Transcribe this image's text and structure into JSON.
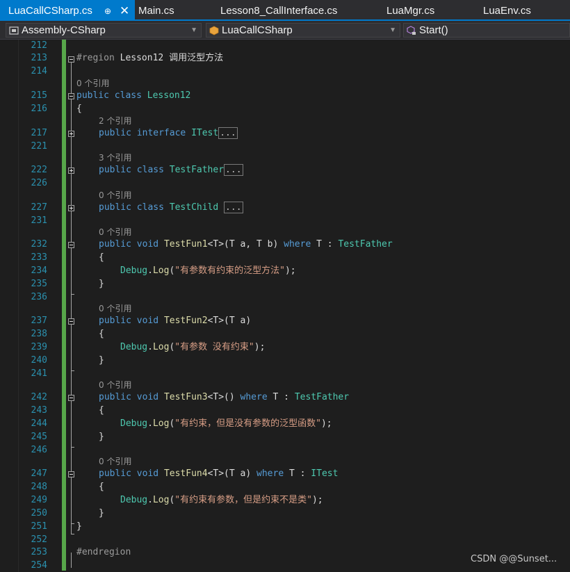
{
  "tabs": [
    {
      "label": "LuaCallCSharp.cs",
      "active": true
    },
    {
      "label": "Main.cs"
    },
    {
      "label": "Lesson8_CallInterface.cs"
    },
    {
      "label": "LuaMgr.cs"
    },
    {
      "label": "LuaEnv.cs"
    }
  ],
  "tab_pin_glyph": "⊕",
  "tab_close_glyph": "✕",
  "nav": {
    "project": "Assembly-CSharp",
    "type": "LuaCallCSharp",
    "member": "Start()"
  },
  "colors": {
    "accent": "#007acc",
    "keyword": "#569cd6",
    "type": "#4ec9b0",
    "method": "#dcdcaa",
    "string": "#d69d85",
    "line_number": "#2b91af",
    "changed_bar": "#57a64a"
  },
  "line_numbers": [
    "212",
    "213",
    "214",
    "215",
    "216",
    "217",
    "221",
    "222",
    "226",
    "227",
    "231",
    "232",
    "233",
    "234",
    "235",
    "236",
    "237",
    "238",
    "239",
    "240",
    "241",
    "242",
    "243",
    "244",
    "245",
    "246",
    "247",
    "248",
    "249",
    "250",
    "251",
    "252",
    "253",
    "254"
  ],
  "refs": {
    "class_refs": "0 个引用",
    "itest_refs": "2 个引用",
    "testfather_refs": "3 个引用",
    "testchild_refs": "0 个引用",
    "fun1_refs": "0 个引用",
    "fun2_refs": "0 个引用",
    "fun3_refs": "0 个引用",
    "fun4_refs": "0 个引用"
  },
  "code": {
    "region_kw": "#region",
    "region_name": " Lesson12 调用泛型方法",
    "public": "public",
    "class": "class",
    "interface": "interface",
    "void": "void",
    "where": "where",
    "class_name": "Lesson12",
    "itest": "ITest",
    "testfather": "TestFather",
    "testchild": "TestChild",
    "collapsed": "...",
    "open_brace": "{",
    "close_brace": "}",
    "fun1": "TestFun1",
    "fun2": "TestFun2",
    "fun3": "TestFun3",
    "fun4": "TestFun4",
    "generic_t": "<T>",
    "t": "T",
    "params_ab_open": "(",
    "params_a": " a, ",
    "params_b": " b) ",
    "params_a_close": " a)",
    "params_a_close_sp": " a) ",
    "empty_params": "() ",
    "colon": " : ",
    "sp": " ",
    "debug": "Debug",
    "dot": ".",
    "log": "Log",
    "paren_open": "(",
    "paren_close": ");",
    "str1": "\"有参数有约束的泛型方法\"",
    "str2": "\"有参数 没有约束\"",
    "str3": "\"有约束，但是没有参数的泛型函数\"",
    "str4": "\"有约束有参数，但是约束不是类\"",
    "endregion": "#endregion"
  },
  "watermark": "CSDN @@Sunset..."
}
